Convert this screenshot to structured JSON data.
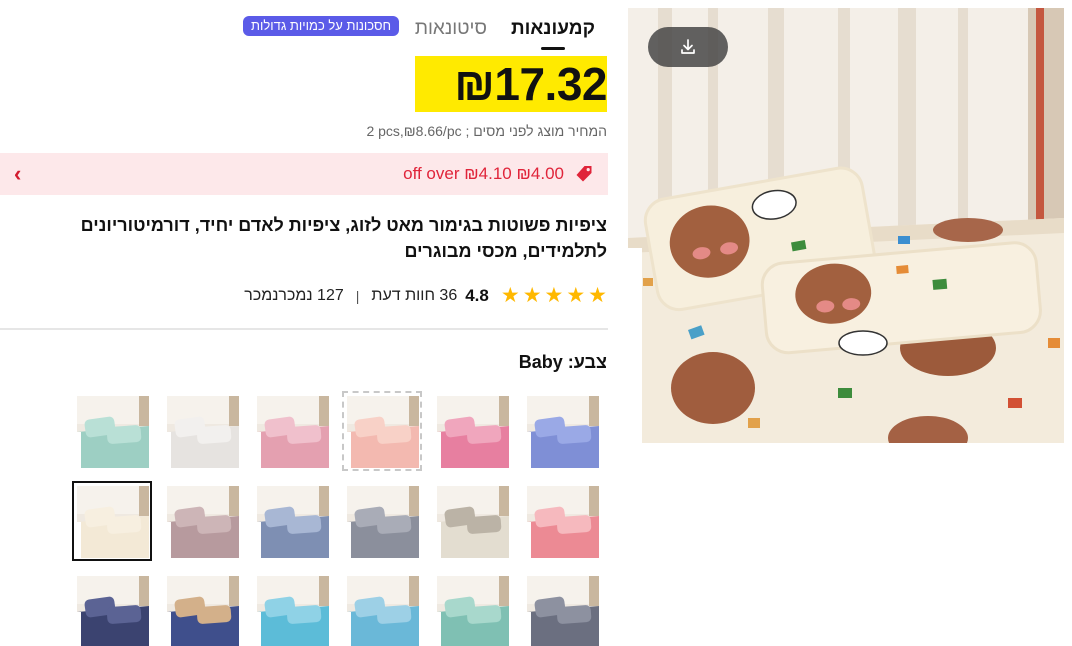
{
  "tabs": [
    {
      "label": "קמעונאות",
      "active": true
    },
    {
      "label": "סיטונאות",
      "active": false
    }
  ],
  "bulk_badge": "חסכונות על כמויות גדולות",
  "price": {
    "amount": "17.32",
    "currency_symbol": "₪",
    "highlight_color": "#ffea00"
  },
  "unit_price_text": "2 pcs,₪8.66/pc ; המחיר מוצג לפני מסים",
  "promo": {
    "text": "off over ₪4.10 ₪4.00",
    "icon": "tag-icon",
    "chevron": "chevron-left-icon",
    "color": "#e0243a"
  },
  "product_title": "ציפיות פשוטות בגימור מאט לזוג, ציפיות לאדם יחיד, דורמיטוריונים לתלמידים, מכסי מבוגרים",
  "rating": {
    "value": "4.8",
    "stars": 5,
    "reviews_count": "36",
    "reviews_label": "חוות דעת",
    "separator": "|",
    "sold_count": "127",
    "sold_label": "נמכרנמכר"
  },
  "color_label": "צבע: Baby",
  "swatches": [
    {
      "name": "blue",
      "bg": "#7f8fd6",
      "pillow": "#9aa9e6",
      "selected": false
    },
    {
      "name": "pink-plaid",
      "bg": "#e77fa0",
      "pillow": "#f0a6bd",
      "selected": false
    },
    {
      "name": "peach-light",
      "bg": "#f3b9b0",
      "pillow": "#f8d1c7",
      "selected": false,
      "dashed": true
    },
    {
      "name": "pink",
      "bg": "#e4a0b0",
      "pillow": "#f0c0cc",
      "selected": false
    },
    {
      "name": "white-geo",
      "bg": "#e6e3e0",
      "pillow": "#f2f0ee",
      "selected": false
    },
    {
      "name": "mint",
      "bg": "#9dcfc3",
      "pillow": "#b9e0d6",
      "selected": false
    },
    {
      "name": "pink-animal",
      "bg": "#ec8a94",
      "pillow": "#f6b9be",
      "selected": false
    },
    {
      "name": "plaid-black",
      "bg": "#e3ddd0",
      "pillow": "#bbb3a6",
      "selected": false
    },
    {
      "name": "grey",
      "bg": "#8b8f9c",
      "pillow": "#a9acb7",
      "selected": false
    },
    {
      "name": "stripe-blue",
      "bg": "#7e8fb3",
      "pillow": "#a8b7d4",
      "selected": false
    },
    {
      "name": "mauve",
      "bg": "#b79a9e",
      "pillow": "#cdb5b7",
      "selected": false
    },
    {
      "name": "baby",
      "bg": "#f3e9d6",
      "pillow": "#f7efe0",
      "selected": true
    },
    {
      "name": "grey-check",
      "bg": "#6b6f80",
      "pillow": "#8d91a0",
      "selected": false
    },
    {
      "name": "mint-dog",
      "bg": "#7fc0b3",
      "pillow": "#a8d8cc",
      "selected": false
    },
    {
      "name": "sky-pattern",
      "bg": "#6ab8d8",
      "pillow": "#9dd0e6",
      "selected": false
    },
    {
      "name": "aqua-dino",
      "bg": "#5cbcd8",
      "pillow": "#8fd2e6",
      "selected": false
    },
    {
      "name": "navy-corgi",
      "bg": "#3f4f8c",
      "pillow": "#d3b08a",
      "selected": false
    },
    {
      "name": "navy-star",
      "bg": "#3b4370",
      "pillow": "#5b6394",
      "selected": false
    }
  ]
}
